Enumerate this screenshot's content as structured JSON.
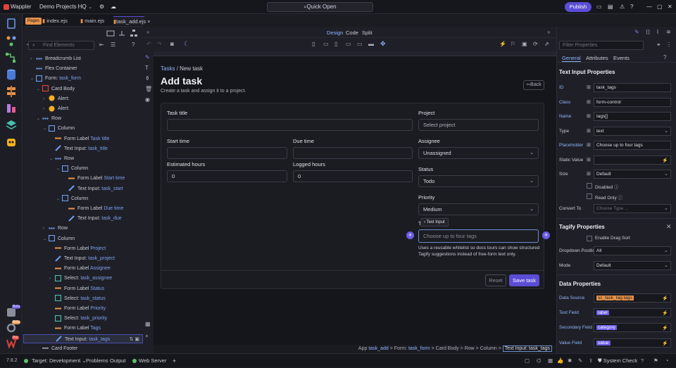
{
  "app": {
    "brand": "Wappler",
    "project": "Demo Projects HQ",
    "quick_open": "Quick Open",
    "publish": "Publish"
  },
  "colors": {
    "accent": "#5b4dd6",
    "link": "#7ea0f0",
    "bolt": "#f5b120",
    "tag_orange": "#e8934a",
    "tag_purple": "#6b5ce7"
  },
  "tabs": {
    "pages_badge": "Pages",
    "items": [
      "index.ejs",
      "main.ejs",
      "task_add.ejs"
    ]
  },
  "tree": {
    "find_placeholder": "Find Elements",
    "rows": [
      {
        "icon": "dots",
        "label": "Breadcrumb List",
        "name": ""
      },
      {
        "icon": "dots",
        "label": "Flex Container",
        "name": ""
      },
      {
        "icon": "form",
        "label": "Form: ",
        "name": "task_form"
      },
      {
        "icon": "card",
        "label": "Card Body",
        "name": ""
      },
      {
        "icon": "alert",
        "label": "Alert:",
        "name": ""
      },
      {
        "icon": "alert",
        "label": "Alert:",
        "name": ""
      },
      {
        "icon": "dots",
        "label": "Row",
        "name": ""
      },
      {
        "icon": "col",
        "label": "Column",
        "name": ""
      },
      {
        "icon": "flabel",
        "label": "Form Label ",
        "name": "Task title"
      },
      {
        "icon": "pen",
        "label": "Text Input: ",
        "name": "task_title"
      },
      {
        "icon": "dots",
        "label": "Row",
        "name": ""
      },
      {
        "icon": "col",
        "label": "Column",
        "name": ""
      },
      {
        "icon": "flabel",
        "label": "Form Label ",
        "name": "Start time"
      },
      {
        "icon": "pen",
        "label": "Text Input: ",
        "name": "task_start"
      },
      {
        "icon": "col",
        "label": "Column",
        "name": ""
      },
      {
        "icon": "flabel",
        "label": "Form Label ",
        "name": "Due time"
      },
      {
        "icon": "pen",
        "label": "Text Input: ",
        "name": "task_due"
      },
      {
        "icon": "dots",
        "label": "Row",
        "name": ""
      },
      {
        "icon": "col",
        "label": "Column",
        "name": ""
      },
      {
        "icon": "flabel",
        "label": "Form Label ",
        "name": "Project"
      },
      {
        "icon": "pen",
        "label": "Text Input: ",
        "name": "task_project"
      },
      {
        "icon": "flabel",
        "label": "Form Label ",
        "name": "Assignee"
      },
      {
        "icon": "select",
        "label": "Select: ",
        "name": "task_assignee"
      },
      {
        "icon": "flabel",
        "label": "Form Label ",
        "name": "Status"
      },
      {
        "icon": "select",
        "label": "Select: ",
        "name": "task_status"
      },
      {
        "icon": "flabel",
        "label": "Form Label ",
        "name": "Priority"
      },
      {
        "icon": "select",
        "label": "Select: ",
        "name": "task_priority"
      },
      {
        "icon": "flabel",
        "label": "Form Label ",
        "name": "Tags"
      },
      {
        "icon": "pen",
        "label": "Text Input: ",
        "name": "task_tags"
      },
      {
        "icon": "line",
        "label": "Card Footer",
        "name": ""
      }
    ]
  },
  "canvas": {
    "views": [
      "Design",
      "Code",
      "Split"
    ],
    "breadcrumb": [
      "Tasks",
      "/",
      "New task"
    ],
    "title": "Add task",
    "subtitle": "Create a task and assign it to a project.",
    "back": "Back",
    "fields": {
      "task_title": "Task title",
      "project": "Project",
      "project_value": "Select project",
      "start_time": "Start time",
      "due_time": "Due time",
      "assignee": "Assignee",
      "assignee_value": "Unassigned",
      "estimated_hours": "Estimated hours",
      "estimated_value": "0",
      "logged_hours": "Logged hours",
      "logged_value": "0",
      "status": "Status",
      "status_value": "Todo",
      "priority": "Priority",
      "priority_value": "Medium",
      "tags_label": "T",
      "tags_placeholder": "Choose up to four tags",
      "tags_help": "Uses a reusable whitelist so docs tours can show structured Tagify suggestions instead of free-form text only."
    },
    "badge": "Text Input",
    "reset": "Reset",
    "save": "Save task"
  },
  "pathbar": {
    "prefix": "App ",
    "parts": [
      "task_add",
      " > Form: ",
      "task_form",
      " > Card Body > Row > Column > "
    ],
    "current": "Text Input: task_tags"
  },
  "props": {
    "filter_placeholder": "Filter Properties",
    "tabs": [
      "General",
      "Attributes",
      "Events"
    ],
    "section1": "Text Input Properties",
    "rows": [
      {
        "label": "ID",
        "value": "task_tags"
      },
      {
        "label": "Class",
        "value": "form-control"
      },
      {
        "label": "Name",
        "value": "tags[]"
      },
      {
        "label": "Type",
        "value": "text"
      },
      {
        "label": "Placeholder",
        "value": "Choose up to four tags"
      },
      {
        "label": "Static Value",
        "value": ""
      },
      {
        "label": "Size",
        "value": "Default"
      }
    ],
    "disabled": "Disabled",
    "readonly": "Read Only",
    "convert_to": "Convert To",
    "convert_placeholder": "Choose Type ...",
    "section2": "Tagify Properties",
    "drag_sort": "Enable Drag Sort",
    "dropdown_position": "Dropdown Position",
    "dropdown_position_value": "All",
    "mode": "Mode",
    "mode_value": "Default",
    "section3": "Data Properties",
    "data_source": "Data Source",
    "data_source_value": "sc_task_tag.tags",
    "text_field": "Text Field",
    "text_field_value": "label",
    "secondary_field": "Secondary Field",
    "secondary_field_value": "category",
    "value_field": "Value Field",
    "value_field_value": "value"
  },
  "status": {
    "version": "7.8.2",
    "target": "Target: Development",
    "problems": "Problems",
    "output": "Output",
    "web_server": "Web Server",
    "system_check": "System Check",
    "beta1": "Beta",
    "beta2": "Beta",
    "beta3": "Pro"
  }
}
